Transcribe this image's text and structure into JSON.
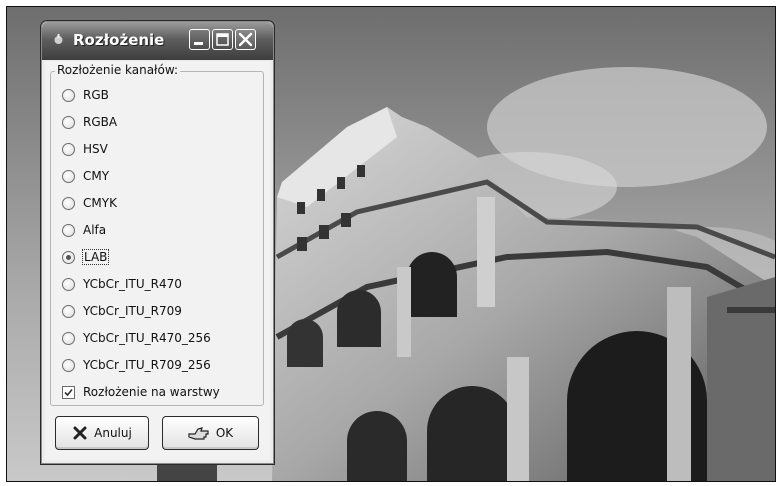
{
  "dialog": {
    "title": "Rozłożenie",
    "group_label": "Rozłożenie kanałów:",
    "options": [
      "RGB",
      "RGBA",
      "HSV",
      "CMY",
      "CMYK",
      "Alfa",
      "LAB",
      "YCbCr_ITU_R470",
      "YCbCr_ITU_R709",
      "YCbCr_ITU_R470_256",
      "YCbCr_ITU_R709_256"
    ],
    "selected": "LAB",
    "layers_checkbox_label": "Rozłożenie na warstwy",
    "layers_checked": true,
    "cancel_label": "Anuluj",
    "ok_label": "OK"
  },
  "icons": {
    "title": "gimp-wilber-icon",
    "minimize": "minimize-icon",
    "maximize": "maximize-icon",
    "close": "close-icon",
    "cancel": "cancel-x-icon",
    "ok": "ok-hand-icon"
  }
}
